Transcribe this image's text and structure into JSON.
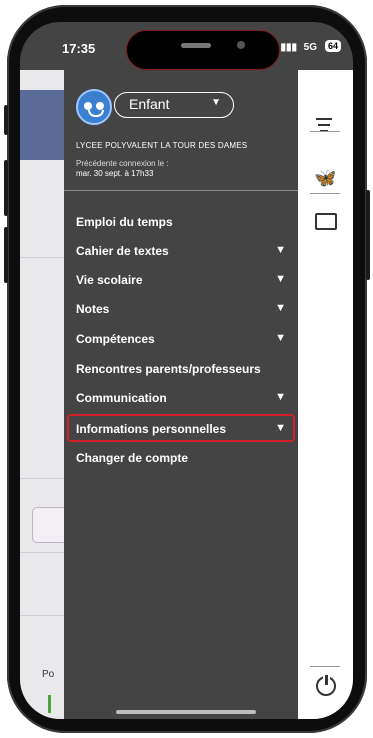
{
  "status_bar": {
    "time": "17:35",
    "network": "5G",
    "battery": "64"
  },
  "header": {
    "profile_select": "Enfant",
    "school_name": "LYCEE POLYVALENT LA TOUR DES DAMES",
    "last_connection_label": "Précédente connexion le :",
    "last_connection_date": "mar. 30 sept. à 17h33"
  },
  "menu": {
    "items": [
      {
        "label": "Emploi du temps",
        "has_submenu": false
      },
      {
        "label": "Cahier de textes",
        "has_submenu": true
      },
      {
        "label": "Vie scolaire",
        "has_submenu": true
      },
      {
        "label": "Notes",
        "has_submenu": true
      },
      {
        "label": "Compétences",
        "has_submenu": true
      },
      {
        "label": "Rencontres parents/professeurs",
        "has_submenu": false
      },
      {
        "label": "Communication",
        "has_submenu": true
      },
      {
        "label": "Informations personnelles",
        "has_submenu": true,
        "highlighted": true
      },
      {
        "label": "Changer de compte",
        "has_submenu": false
      }
    ]
  },
  "background_app": {
    "visible_text": "Po"
  },
  "icons": {
    "menu": "hamburger-icon",
    "butterfly": "butterfly-icon",
    "id_card": "id-card-icon",
    "power": "power-icon",
    "chevron": "chevron-down-icon"
  },
  "colors": {
    "menu_bg": "#444444",
    "highlight": "#d11f2b",
    "avatar": "#3b7fd0"
  }
}
